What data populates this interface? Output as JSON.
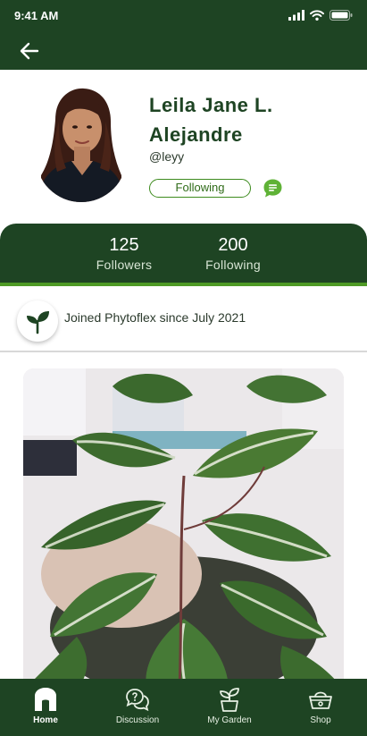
{
  "status_bar": {
    "time": "9:41 AM"
  },
  "profile": {
    "name": "Leila Jane L. Alejandre",
    "handle": "@leyy",
    "follow_button_label": "Following"
  },
  "stats": [
    {
      "value": "125",
      "label": "Followers"
    },
    {
      "value": "200",
      "label": "Following"
    }
  ],
  "joined_text": "Joined Phytoflex since July 2021",
  "bottom_nav": [
    {
      "label": "Home",
      "icon": "home-icon",
      "active": true
    },
    {
      "label": "Discussion",
      "icon": "discussion-icon",
      "active": false
    },
    {
      "label": "My Garden",
      "icon": "plant-pot-icon",
      "active": false
    },
    {
      "label": "Shop",
      "icon": "basket-icon",
      "active": false
    }
  ],
  "colors": {
    "primary": "#1e4423",
    "accent": "#4e9a25",
    "chat": "#5fb236"
  }
}
